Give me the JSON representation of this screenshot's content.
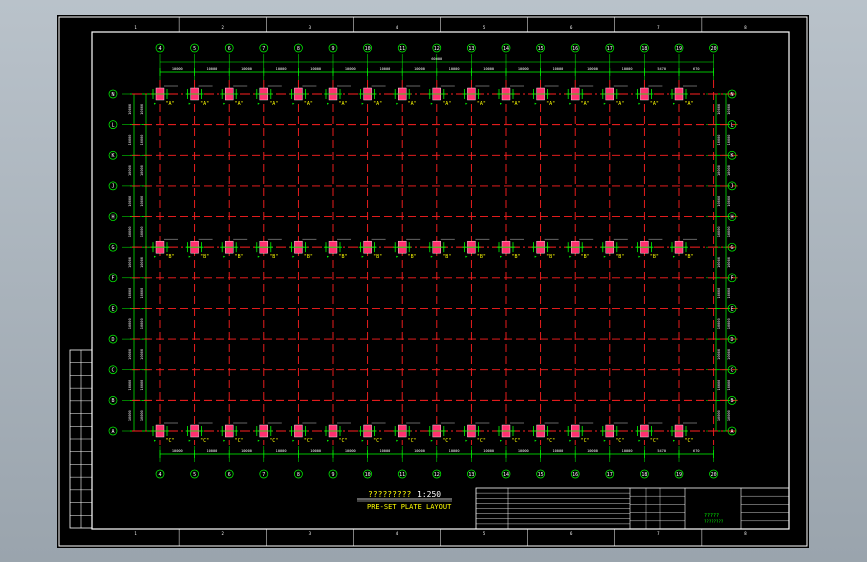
{
  "drawing": {
    "title_cn": "?????????",
    "scale": "1:250",
    "title_en": "PRE-SET PLATE LAYOUT",
    "block_title": "?????",
    "block_subtitle": "????????"
  },
  "grid": {
    "columns": [
      "4",
      "5",
      "6",
      "7",
      "8",
      "9",
      "10",
      "11",
      "12",
      "13",
      "14",
      "15",
      "16",
      "17",
      "18",
      "19",
      "20"
    ],
    "rows": [
      "N",
      "L",
      "K",
      "J",
      "H",
      "G",
      "F",
      "E",
      "D",
      "C",
      "B",
      "A"
    ],
    "top_dims": [
      "10000",
      "10000",
      "10000",
      "10000",
      "10000",
      "10000",
      "10000",
      "10000",
      "10000",
      "10000",
      "10000",
      "10000",
      "10000",
      "10000",
      "5470",
      "670"
    ],
    "bottom_dims": [
      "10000",
      "10000",
      "10000",
      "10000",
      "10000",
      "10000",
      "10000",
      "10000",
      "10000",
      "10000",
      "10000",
      "10000",
      "10000",
      "10000",
      "5470",
      "670"
    ],
    "overall_dim": "60000",
    "side_dims": [
      "10000",
      "10000",
      "10000",
      "10000",
      "10000",
      "10000",
      "10000",
      "10000",
      "10000",
      "10000",
      "10000"
    ],
    "plate_labels": {
      "top": "\"A\"",
      "middle": "\"B\"",
      "bottom": "\"C\""
    },
    "frame_numbers": [
      "1",
      "2",
      "3",
      "4",
      "5",
      "6",
      "7",
      "8"
    ]
  },
  "colors": {
    "background": "#000000",
    "frame": "#ffffff",
    "grid_lines": "#ff2020",
    "dimension": "#00ff00",
    "axis_bubble": "#00ff00",
    "plate": "#ff3070",
    "text_yellow": "#ffff00"
  }
}
